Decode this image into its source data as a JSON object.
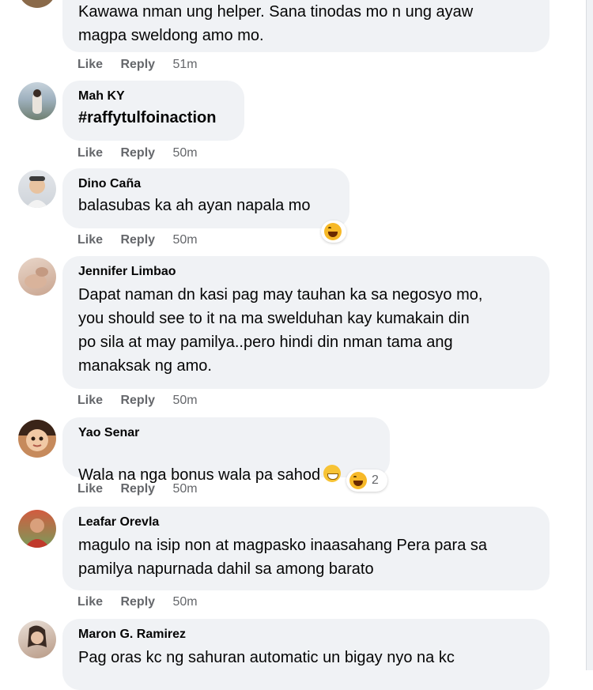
{
  "comments": [
    {
      "name": "",
      "text": "Kawawa nman ung helper. Sana tinodas mo n ung ayaw\nmagpa sweldong amo mo.",
      "like": "Like",
      "reply": "Reply",
      "time": "51m"
    },
    {
      "name": "Mah KY",
      "text": "#raffytulfoinaction",
      "like": "Like",
      "reply": "Reply",
      "time": "50m"
    },
    {
      "name": "Dino Caña",
      "text": "balasubas ka ah ayan napala mo",
      "like": "Like",
      "reply": "Reply",
      "time": "50m",
      "reaction": {
        "icon": "haha-reaction-icon"
      }
    },
    {
      "name": "Jennifer Limbao",
      "text": "Dapat naman dn kasi pag may tauhan ka sa negosyo mo,\nyou should see to it na ma swelduhan kay kumakain din\npo sila at may pamilya..pero hindi din nman tama ang\nmanaksak ng amo.",
      "like": "Like",
      "reply": "Reply",
      "time": "50m"
    },
    {
      "name": "Yao Senar",
      "text": "Wala na nga bonus wala pa sahod",
      "inline_emoji": "grinning-face-icon",
      "like": "Like",
      "reply": "Reply",
      "time": "50m",
      "reaction": {
        "icon": "haha-reaction-icon",
        "count": "2"
      }
    },
    {
      "name": "Leafar Orevla",
      "text": "magulo na isip non at magpasko inaasahang Pera para sa\npamilya napurnada dahil sa among barato",
      "like": "Like",
      "reply": "Reply",
      "time": "50m"
    },
    {
      "name": "Maron G. Ramirez",
      "text": "Pag oras kc ng sahuran automatic un bigay nyo na kc"
    }
  ],
  "colors": {
    "bubble": "#f0f2f5",
    "meta": "#65676b",
    "text": "#050505"
  }
}
